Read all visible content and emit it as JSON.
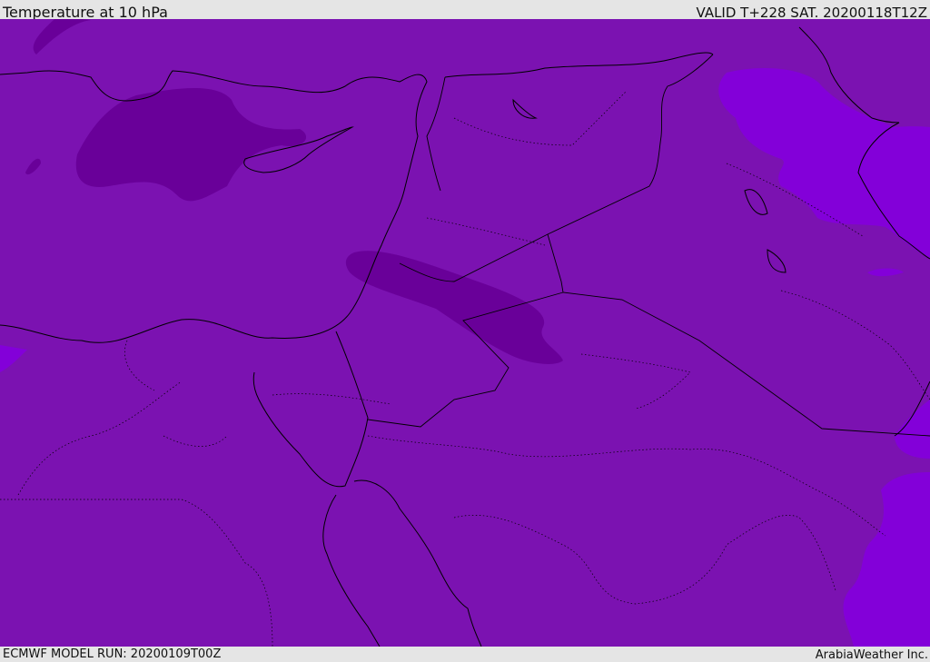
{
  "header": {
    "title": "Temperature at 10 hPa",
    "valid": "VALID T+228 SAT. 20200118T12Z"
  },
  "footer": {
    "model_run": "ECMWF MODEL RUN: 20200109T00Z",
    "credit": "ArabiaWeather Inc."
  },
  "colors": {
    "base": "#7b12b1",
    "cold": "#690099",
    "warm": "#8300d9",
    "border": "#000000"
  }
}
